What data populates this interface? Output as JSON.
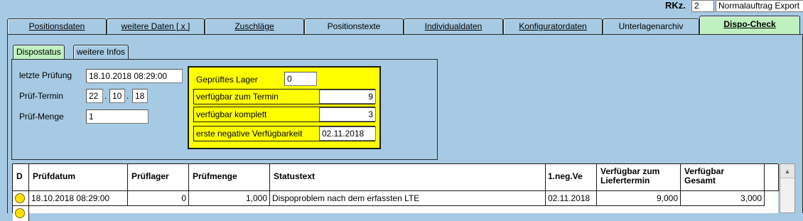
{
  "header": {
    "rkz_label": "RKz.",
    "rkz_value": "2",
    "mode": "Normalauftrag Export"
  },
  "tabs": [
    {
      "label": "Positionsdaten"
    },
    {
      "label": "weitere Daten [ x ]"
    },
    {
      "label": "Zuschläge"
    },
    {
      "label": "Positionstexte"
    },
    {
      "label": "Individualdaten"
    },
    {
      "label": "Konfiguratordaten"
    },
    {
      "label": "Unterlagenarchiv"
    },
    {
      "label": "Dispo-Check"
    }
  ],
  "subtabs": [
    {
      "label": "Dispostatus"
    },
    {
      "label": "weitere Infos"
    }
  ],
  "dispo": {
    "letzte_pruefung_label": "letzte Prüfung",
    "letzte_pruefung_value": "18.10.2018 08:29:00",
    "pruef_termin_label": "Prüf-Termin",
    "pruef_termin_day": "22",
    "pruef_termin_month": "10",
    "pruef_termin_year": "18",
    "date_sep": ".",
    "pruef_menge_label": "Prüf-Menge",
    "pruef_menge_value": "1"
  },
  "lager": {
    "gepruefte_label": "Geprüftes Lager",
    "gepruefte_value": "0",
    "verf_termin_label": "verfügbar zum Termin",
    "verf_termin_value": "9",
    "verf_komplett_label": "verfügbar komplett",
    "verf_komplett_value": "3",
    "erste_neg_label": "erste negative Verfügbarkeit",
    "erste_neg_value": "02.11.2018"
  },
  "table": {
    "headers": {
      "d": "D",
      "pruefdatum": "Prüfdatum",
      "prueflager": "Prüflager",
      "pruefmenge": "Prüfmenge",
      "statustext": "Statustext",
      "neg": "1.neg.Ve",
      "verf_liefer_1": "Verfügbar zum",
      "verf_liefer_2": "Liefertermin",
      "verf_gesamt_1": "Verfügbar",
      "verf_gesamt_2": "Gesamt"
    },
    "rows": [
      {
        "status_color": "#ffe000",
        "pruefdatum": "18.10.2018 08:29:00",
        "prueflager": "0",
        "pruefmenge": "1,000",
        "statustext": "Dispoproblem nach dem erfassten LTE",
        "neg": "02.11.2018",
        "verf_liefer": "9,000",
        "verf_gesamt": "3,000"
      }
    ]
  }
}
